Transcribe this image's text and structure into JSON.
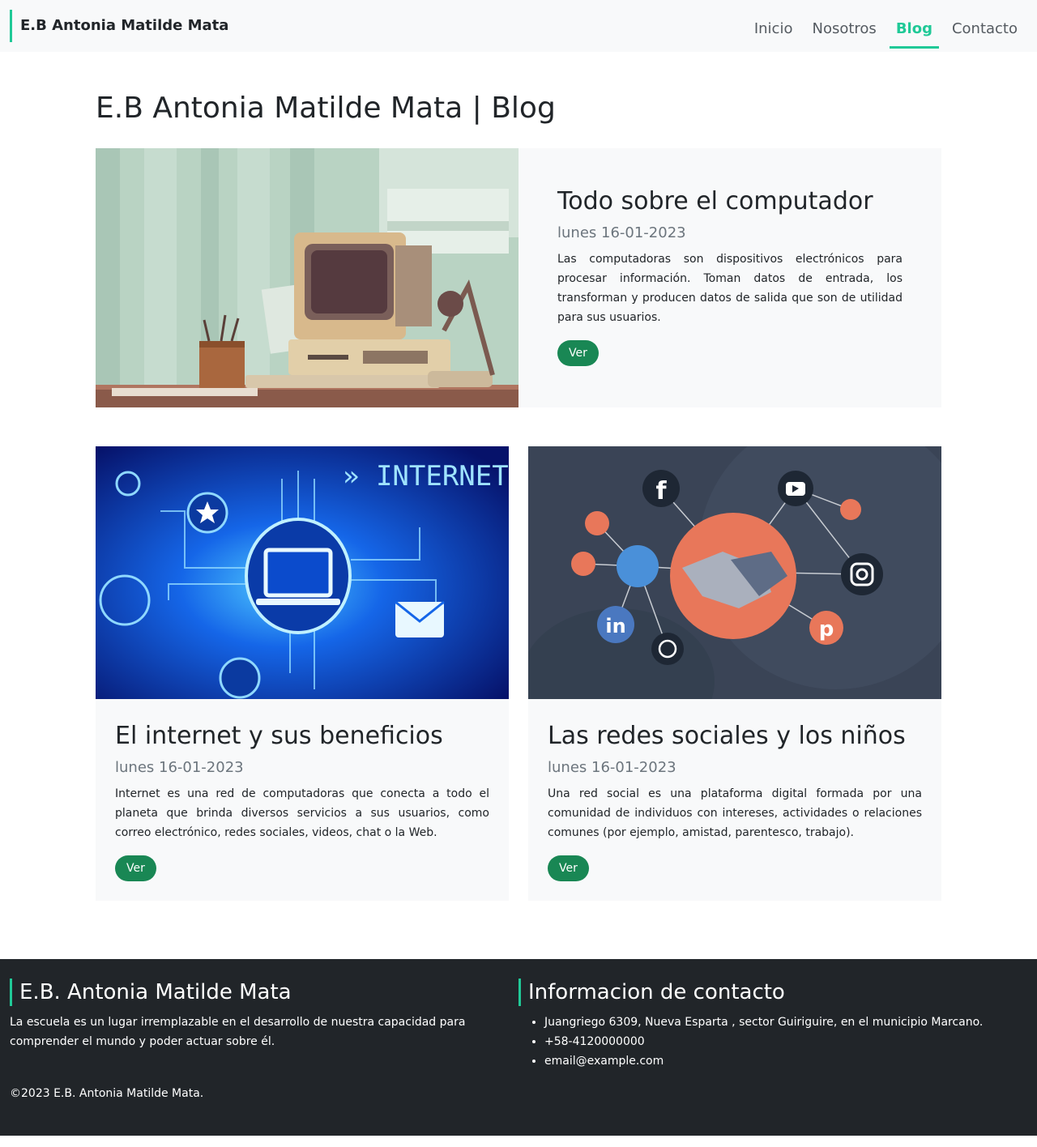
{
  "navbar": {
    "brand": "E.B Antonia Matilde Mata",
    "links": [
      {
        "label": "Inicio"
      },
      {
        "label": "Nosotros"
      },
      {
        "label": "Blog"
      },
      {
        "label": "Contacto"
      }
    ],
    "active": "Blog"
  },
  "main": {
    "title": "E.B Antonia Matilde Mata | Blog",
    "featured": {
      "title": "Todo sobre el computador",
      "date": "lunes 16-01-2023",
      "text": "Las computadoras son dispositivos electrónicos para procesar información. Toman datos de entrada, los transforman y producen datos de salida que son de utilidad para sus usuarios.",
      "button": "Ver"
    },
    "cards": [
      {
        "title": "El internet y sus beneficios",
        "date": "lunes 16-01-2023",
        "text": "Internet es una red de computadoras que conecta a todo el planeta que brinda diversos servicios a sus usuarios, como correo electrónico, redes sociales, videos, chat o la Web.",
        "button": "Ver",
        "image_label": "» INTERNET «"
      },
      {
        "title": "Las redes sociales y los niños",
        "date": "lunes 16-01-2023",
        "text": "Una red social es una plataforma digital formada por una comunidad de individuos con intereses, actividades o relaciones comunes (por ejemplo, amistad, parentesco, trabajo).",
        "button": "Ver"
      }
    ]
  },
  "footer": {
    "about_title": "E.B. Antonia Matilde Mata",
    "about_text": "La escuela es un lugar irremplazable en el desarrollo de nuestra capacidad para comprender el mundo y poder actuar sobre él.",
    "contact_title": "Informacion de contacto",
    "contact_items": [
      "Juangriego 6309, Nueva Esparta , sector Guiriguire, en el municipio Marcano.",
      "+58-4120000000",
      "email@example.com"
    ],
    "copyright": "©2023 E.B. Antonia Matilde Mata."
  },
  "colors": {
    "accent": "#20c997",
    "button": "#198754",
    "footer_bg": "#212529",
    "card_bg": "#f8f9fa"
  }
}
